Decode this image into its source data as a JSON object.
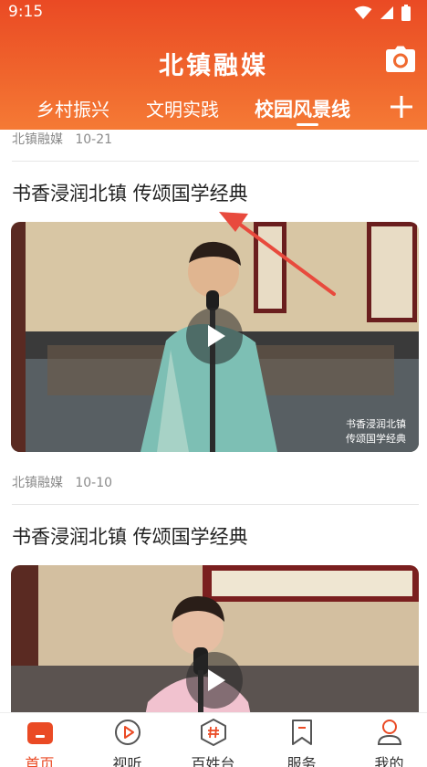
{
  "status": {
    "time": "9:15"
  },
  "header": {
    "title": "北镇融媒",
    "tabs": [
      {
        "label": "乡村振兴"
      },
      {
        "label": "文明实践"
      },
      {
        "label": "校园风景线",
        "active": true
      }
    ]
  },
  "feed": {
    "items": [
      {
        "source": "北镇融媒",
        "date": "10-21",
        "partial": true
      },
      {
        "title": "书香浸润北镇 传颂国学经典",
        "video_caption": [
          "书香浸润北镇",
          "传颂国学经典"
        ]
      },
      {
        "source": "北镇融媒",
        "date": "10-10",
        "title": "书香浸润北镇 传颂国学经典"
      }
    ]
  },
  "bottom_nav": [
    {
      "label": "首页",
      "icon": "home-icon",
      "active": true
    },
    {
      "label": "视听",
      "icon": "play-circle-icon"
    },
    {
      "label": "百姓台",
      "icon": "hashtag-icon"
    },
    {
      "label": "服务",
      "icon": "bookmark-icon"
    },
    {
      "label": "我的",
      "icon": "user-icon"
    }
  ],
  "colors": {
    "brand": "#ea4a24",
    "accent_gradient_end": "#f57a35"
  }
}
